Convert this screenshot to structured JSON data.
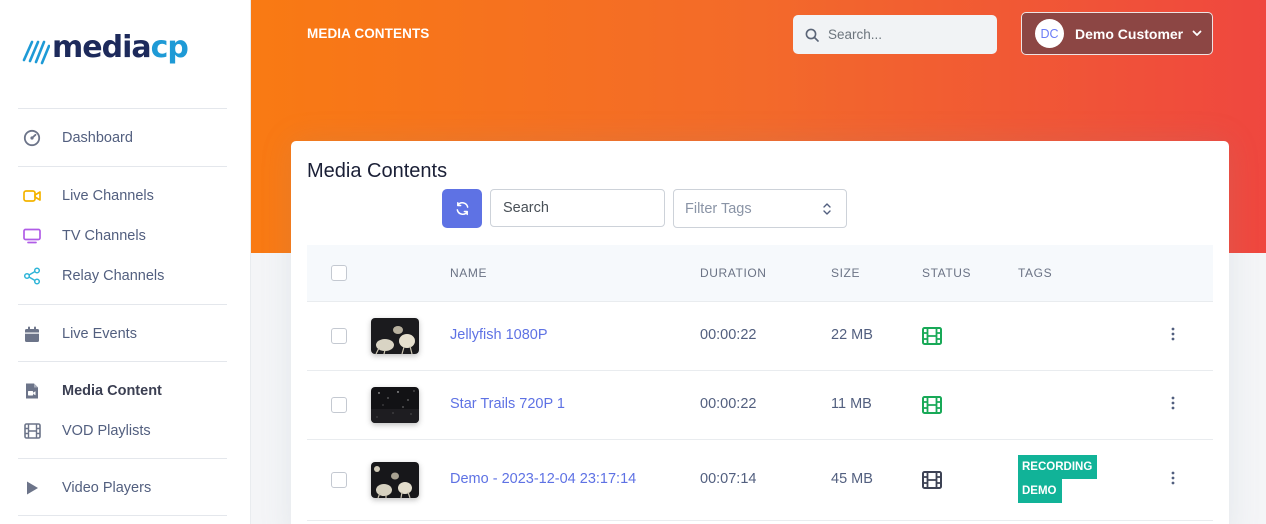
{
  "brand": {
    "logo_part1": "media",
    "logo_part2": "cp"
  },
  "sidebar": {
    "items": [
      {
        "label": "Dashboard",
        "icon": "dashboard-gauge-icon"
      },
      {
        "label": "Live Channels",
        "icon": "video-camera-icon"
      },
      {
        "label": "TV Channels",
        "icon": "tv-icon"
      },
      {
        "label": "Relay Channels",
        "icon": "share-nodes-icon"
      },
      {
        "label": "Live Events",
        "icon": "calendar-icon"
      },
      {
        "label": "Media Content",
        "icon": "file-video-icon",
        "active": true
      },
      {
        "label": "VOD Playlists",
        "icon": "film-icon"
      },
      {
        "label": "Video Players",
        "icon": "play-icon"
      }
    ]
  },
  "header": {
    "title": "MEDIA CONTENTS",
    "search_placeholder": "Search...",
    "user": {
      "initials": "DC",
      "name": "Demo Customer"
    }
  },
  "card": {
    "title": "Media Contents",
    "search_placeholder": "Search",
    "filter_placeholder": "Filter Tags",
    "columns": {
      "name": "NAME",
      "duration": "DURATION",
      "size": "SIZE",
      "status": "STATUS",
      "tags": "TAGS"
    },
    "rows": [
      {
        "name": "Jellyfish 1080P",
        "duration": "00:00:22",
        "size": "22 MB",
        "status": "ready",
        "tags": []
      },
      {
        "name": "Star Trails 720P 1",
        "duration": "00:00:22",
        "size": "11 MB",
        "status": "ready",
        "tags": []
      },
      {
        "name": "Demo - 2023-12-04 23:17:14",
        "duration": "00:07:14",
        "size": "45 MB",
        "status": "recording",
        "tags": [
          "RECORDING",
          "DEMO"
        ]
      }
    ]
  },
  "colors": {
    "accent": "#5e72e4",
    "header_gradient_start": "#f97a13",
    "header_gradient_end": "#ef473f",
    "status_ready": "#2dce89",
    "status_other": "#32325d",
    "tag_bg": "#11b398"
  }
}
